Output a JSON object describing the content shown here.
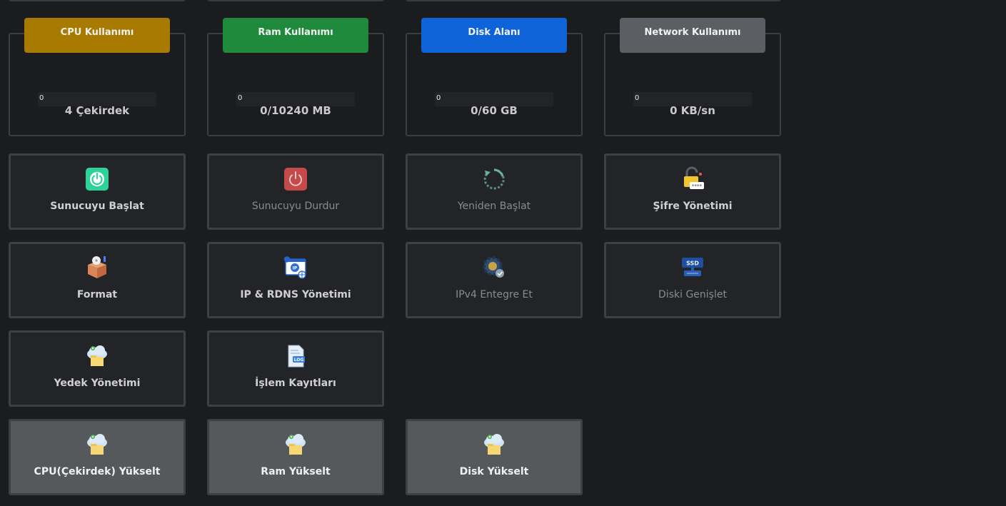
{
  "stats": [
    {
      "title": "CPU Kullanımı",
      "value": "4 Çekirdek",
      "bar": "0",
      "color": "#a87b00"
    },
    {
      "title": "Ram Kullanımı",
      "value": "0/10240 MB",
      "bar": "0",
      "color": "#1f8a3c"
    },
    {
      "title": "Disk Alanı",
      "value": "0/60 GB",
      "bar": "0",
      "color": "#0e63d8"
    },
    {
      "title": "Network Kullanımı",
      "value": "0 KB/sn",
      "bar": "0",
      "color": "#5b5f63"
    }
  ],
  "actions": {
    "start": "Sunucuyu Başlat",
    "stop": "Sunucuyu Durdur",
    "restart": "Yeniden Başlat",
    "password": "Şifre Yönetimi",
    "format": "Format",
    "ip_rdns": "IP & RDNS Yönetimi",
    "ipv4": "IPv4 Entegre Et",
    "disk_expand": "Diski Genişlet",
    "backup": "Yedek Yönetimi",
    "logs": "İşlem Kayıtları",
    "cpu_upgrade": "CPU(Çekirdek) Yükselt",
    "ram_upgrade": "Ram Yükselt",
    "disk_upgrade": "Disk Yükselt"
  },
  "icons": {
    "log_tag": "LOG",
    "ip_tag": "IP",
    "ssd_tag": "SSD",
    "password_mask": "****"
  }
}
